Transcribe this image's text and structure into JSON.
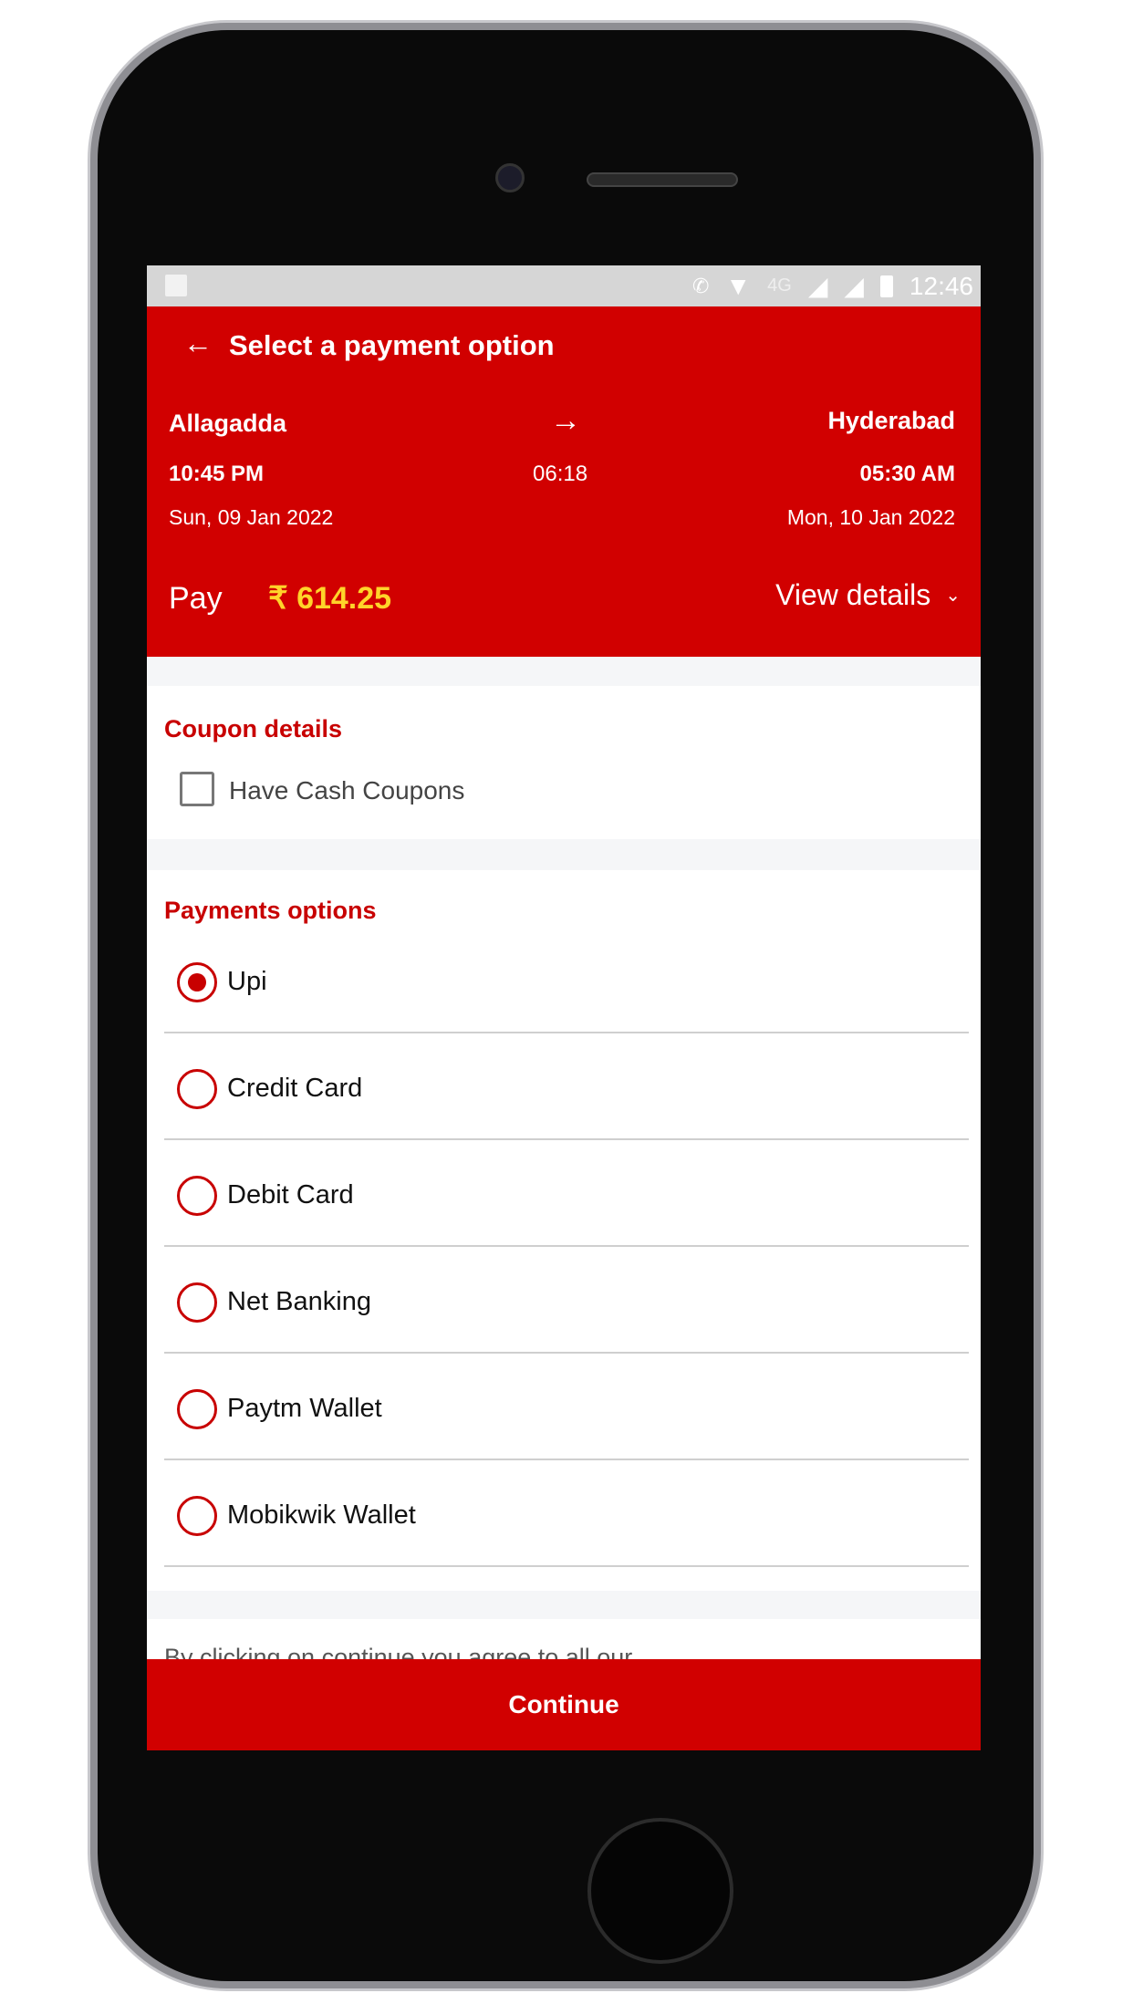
{
  "status_bar": {
    "time": "12:46",
    "network": "4G",
    "icons": [
      "gallery-icon",
      "call-4g-icon",
      "wifi-icon",
      "signal-icon",
      "signal-icon",
      "battery-icon"
    ]
  },
  "header": {
    "title": "Select a payment option",
    "from_city": "Allagadda",
    "to_city": "Hyderabad",
    "depart_time": "10:45 PM",
    "duration": "06:18",
    "arrive_time": "05:30 AM",
    "depart_date": "Sun, 09 Jan 2022",
    "arrive_date": "Mon, 10 Jan 2022",
    "pay_label": "Pay",
    "amount": "₹ 614.25",
    "view_details": "View details"
  },
  "coupon": {
    "title": "Coupon details",
    "checkbox_label": "Have Cash Coupons",
    "checked": false
  },
  "payments": {
    "title": "Payments options",
    "selected": "Upi",
    "options": [
      "Upi",
      "Credit Card",
      "Debit Card",
      "Net Banking",
      "Paytm Wallet",
      "Mobikwik Wallet"
    ]
  },
  "terms_text": "By clicking on continue you agree to all our",
  "continue_label": "Continue",
  "colors": {
    "brand_red": "#d10000",
    "amount_yellow": "#ffd42a",
    "section_red": "#c80000"
  }
}
